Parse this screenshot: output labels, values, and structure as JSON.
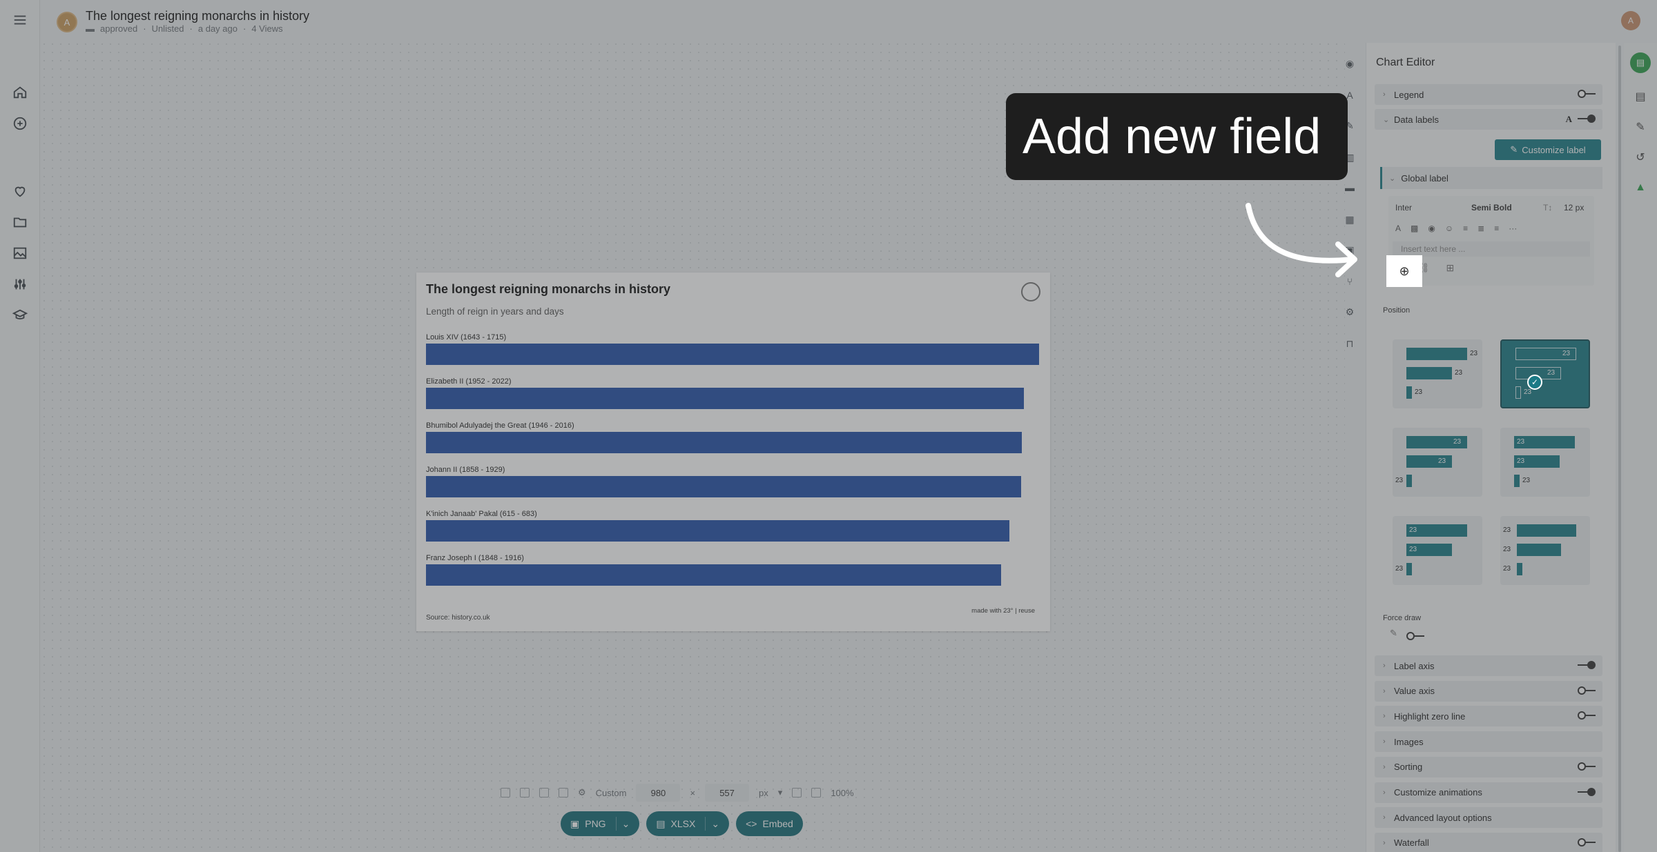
{
  "header": {
    "title": "The longest reigning monarchs in history",
    "avatar_initial": "A",
    "user_initial": "A",
    "meta": {
      "folder": "approved",
      "visibility": "Unlisted",
      "updated": "a day ago",
      "views": "4 Views"
    }
  },
  "left_rail": {
    "items": [
      "menu-icon",
      "home-icon",
      "add-icon",
      "heart-icon",
      "folder-icon",
      "image-icon",
      "sliders-icon",
      "graduation-cap-icon"
    ]
  },
  "chart_data": {
    "type": "bar",
    "title": "The longest reigning monarchs in history",
    "subtitle": "Length of reign in years and days",
    "categories": [
      "Louis XIV (1643 - 1715)",
      "Elizabeth II (1952 - 2022)",
      "Bhumibol Adulyadej the Great (1946 - 2016)",
      "Johann II (1858 - 1929)",
      "K'inich Janaab' Pakal (615 - 683)",
      "Franz Joseph I (1848 - 1916)"
    ],
    "values": [
      72,
      70.2,
      70,
      69.9,
      68.5,
      67.5
    ],
    "xlim": [
      0,
      72
    ],
    "orientation": "horizontal",
    "color": "#2350a8",
    "source": "Source: history.co.uk",
    "credit": "made with 23° | reuse"
  },
  "canvas_toolbar": {
    "size_preset": "Custom",
    "width": "980",
    "times": "×",
    "height": "557",
    "unit": "px",
    "zoom": "100%"
  },
  "export": {
    "png": "PNG",
    "xlsx": "XLSX",
    "embed": "Embed"
  },
  "editor": {
    "title": "Chart Editor",
    "legend": "Legend",
    "data_labels": "Data labels",
    "customize_label": "Customize label",
    "global_label": "Global label",
    "font_family": "Inter",
    "font_weight": "Semi Bold",
    "font_size": "12 px",
    "text_placeholder": "Insert text here ...",
    "position": "Position",
    "position_value": "23",
    "force_draw": "Force draw",
    "sections": [
      {
        "label": "Label axis",
        "toggle": "on"
      },
      {
        "label": "Value axis",
        "toggle": "off"
      },
      {
        "label": "Highlight zero line",
        "toggle": "off"
      },
      {
        "label": "Images",
        "toggle": ""
      },
      {
        "label": "Sorting",
        "toggle": "off"
      },
      {
        "label": "Customize animations",
        "toggle": "on"
      },
      {
        "label": "Advanced layout options",
        "toggle": ""
      },
      {
        "label": "Waterfall",
        "toggle": "off"
      }
    ]
  },
  "tooltip": {
    "text": "Add new field"
  },
  "colors": {
    "accent": "#1b7a86",
    "save": "#2e9e4a",
    "bar": "#2350a8"
  }
}
